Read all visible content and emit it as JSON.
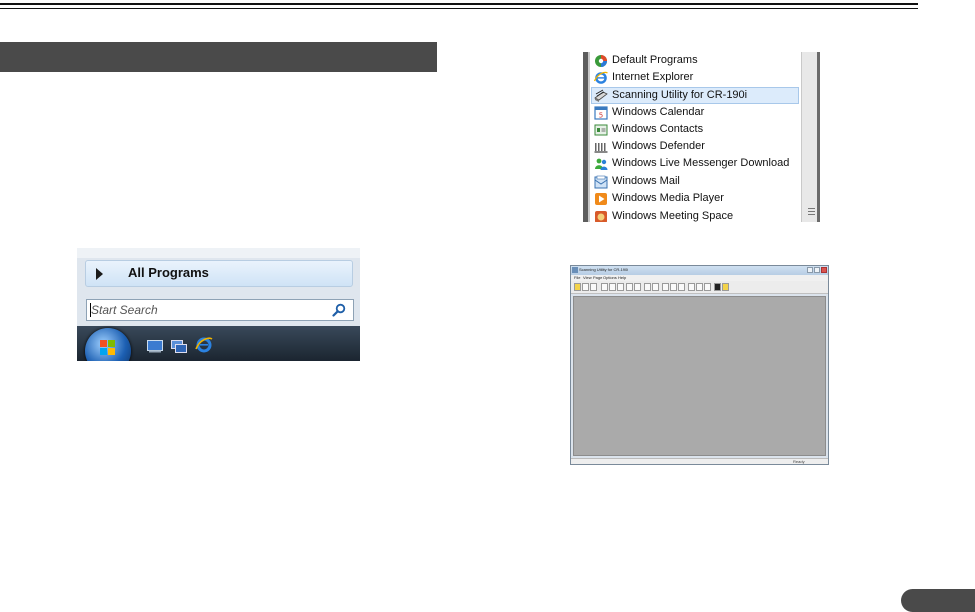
{
  "start_menu": {
    "all_programs_label": "All Programs",
    "search_placeholder": "Start Search"
  },
  "programs_list": {
    "items": [
      {
        "label": "Default Programs",
        "icon": "default-programs-icon",
        "selected": false
      },
      {
        "label": "Internet Explorer",
        "icon": "internet-explorer-icon",
        "selected": false
      },
      {
        "label": "Scanning Utility for CR-190i",
        "icon": "scanning-utility-icon",
        "selected": true
      },
      {
        "label": "Windows Calendar",
        "icon": "calendar-icon",
        "selected": false
      },
      {
        "label": "Windows Contacts",
        "icon": "contacts-icon",
        "selected": false
      },
      {
        "label": "Windows Defender",
        "icon": "defender-icon",
        "selected": false
      },
      {
        "label": "Windows Live Messenger Download",
        "icon": "messenger-icon",
        "selected": false
      },
      {
        "label": "Windows Mail",
        "icon": "mail-icon",
        "selected": false
      },
      {
        "label": "Windows Media Player",
        "icon": "media-player-icon",
        "selected": false
      },
      {
        "label": "Windows Meeting Space",
        "icon": "meeting-space-icon",
        "selected": false
      }
    ]
  },
  "app_window": {
    "title": "Scanning Utility for CR-190i",
    "menus": [
      "File",
      "View",
      "Page",
      "Options",
      "Help"
    ],
    "status_text": "Ready"
  },
  "colors": {
    "section_bar": "#4a4a4a",
    "selection": "#dcebfb",
    "client_area": "#aaaaaa"
  }
}
